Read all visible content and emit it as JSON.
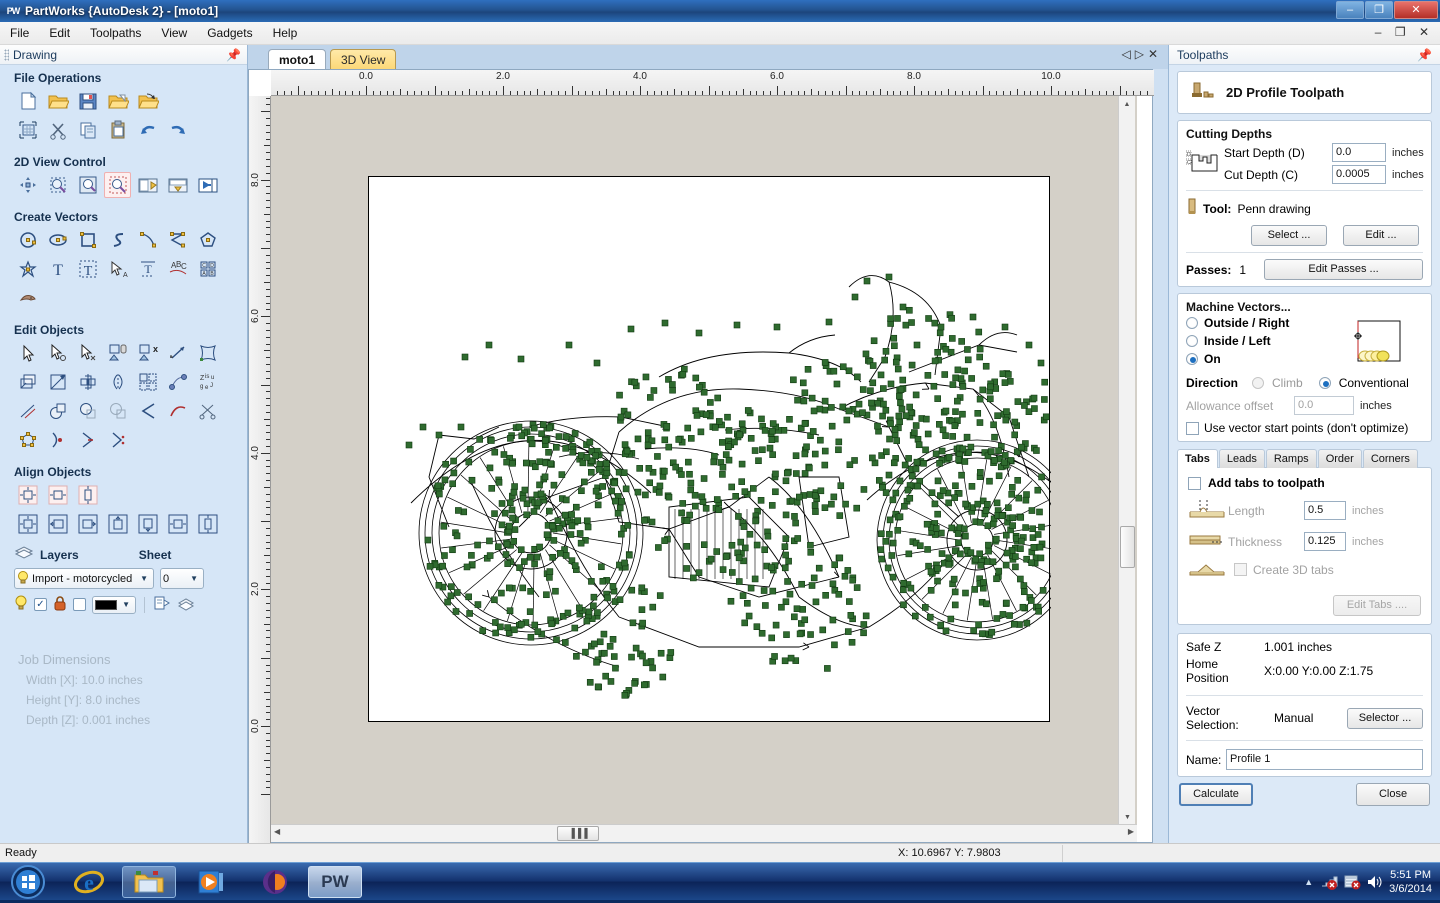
{
  "window": {
    "title": "PartWorks {AutoDesk 2} - [moto1]",
    "icon": "partworks-icon",
    "minimize": "–",
    "maximize": "❐",
    "close": "✕",
    "mdi_restore": "–",
    "mdi_max": "❐",
    "mdi_close": "✕"
  },
  "menubar": {
    "items": [
      {
        "label": "File"
      },
      {
        "label": "Edit"
      },
      {
        "label": "Toolpaths"
      },
      {
        "label": "View"
      },
      {
        "label": "Gadgets"
      },
      {
        "label": "Help"
      }
    ]
  },
  "drawing_panel": {
    "title": "Drawing",
    "pin_icon": "pin-icon",
    "groups": [
      {
        "name": "File Operations",
        "title": "File Operations",
        "rows": [
          [
            "new-file-icon",
            "open-folder-icon",
            "save-disk-icon",
            "open-recent-icon",
            "import-vectors-icon"
          ],
          [
            "job-setup-icon",
            "cut-scissors-icon",
            "copy-icon",
            "paste-icon",
            "undo-icon",
            "redo-icon"
          ]
        ]
      },
      {
        "name": "2D View Control",
        "title": "2D View Control",
        "rows": [
          [
            "pan-icon",
            "zoom-window-icon",
            "zoom-extents-icon",
            "zoom-selected-icon",
            "toggle-left-pane-icon",
            "toggle-top-pane-icon",
            "toggle-right-pane-icon"
          ]
        ]
      },
      {
        "name": "Create Vectors",
        "title": "Create Vectors",
        "rows": [
          [
            "draw-circle-icon",
            "draw-ellipse-icon",
            "draw-rectangle-icon",
            "draw-polyline-icon",
            "draw-arc-icon",
            "draw-polygon-line-icon",
            "draw-polygon-icon"
          ],
          [
            "draw-star-icon",
            "create-text-icon",
            "edit-text-icon",
            "text-select-icon",
            "text-on-curve-icon",
            "arc-text-icon",
            "text-block-icon"
          ],
          [
            "trace-bitmap-icon"
          ]
        ]
      },
      {
        "name": "Edit Objects",
        "title": "Edit Objects",
        "rows": [
          [
            "select-arrow-icon",
            "node-edit-icon",
            "transform-icon",
            "group-icon",
            "ungroup-icon",
            "measure-icon",
            "distort-icon"
          ],
          [
            "offset-icon",
            "scale-icon",
            "mirror-icon",
            "flip-icon",
            "array-copy-icon",
            "join-vectors-icon",
            "nest-icon"
          ],
          [
            "fillet-icon",
            "weld-icon",
            "subtract-icon",
            "intersect-icon",
            "trim-icon",
            "curve-fit-icon",
            "scissors-trim-icon"
          ],
          [
            "polygon-nodes-icon",
            "start-point-icon",
            "reverse-direction-icon",
            "move-start-point-icon"
          ]
        ]
      },
      {
        "name": "Align Objects",
        "title": "Align Objects",
        "rows": [
          [
            "align-center-page-icon",
            "align-horizontal-page-icon",
            "align-vertical-page-icon"
          ],
          [
            "align-center-selection-icon",
            "align-left-icon",
            "align-right-icon",
            "align-top-icon",
            "align-bottom-icon",
            "align-center-h-icon",
            "align-center-v-icon"
          ]
        ]
      }
    ],
    "layers": {
      "icon": "layers-stack-icon",
      "label": "Layers",
      "sheet_label": "Sheet",
      "selected_layer": "Import - motorcycled",
      "layer_lamp_icon": "lightbulb-icon",
      "sheet_value": "0",
      "controls": {
        "visible_icon": "lightbulb-icon",
        "checkbox_checked": "✓",
        "lock_icon": "padlock-icon",
        "blank_checkbox": "",
        "color_swatch": "#000000",
        "layer_props_icon": "layer-properties-icon",
        "merge_layers_icon": "merge-layers-icon"
      }
    },
    "job_dimensions": {
      "title": "Job Dimensions",
      "width": "Width  [X]: 10.0 inches",
      "height": "Height [Y]: 8.0 inches",
      "depth": "Depth  [Z]: 0.001 inches"
    }
  },
  "document": {
    "tabs": [
      {
        "label": "moto1",
        "active": true
      },
      {
        "label": "3D View",
        "active": false
      }
    ],
    "nav_prev": "◁",
    "nav_next": "▷",
    "close": "✕",
    "ruler_h_labels": [
      "0.0",
      "2.0",
      "4.0",
      "6.0",
      "8.0",
      "10.0"
    ],
    "ruler_v_labels": [
      "8.0",
      "6.0",
      "4.0",
      "2.0",
      "0.0"
    ],
    "hscroll_thumb_glyph": "▐▐▐",
    "vscroll_up": "▲",
    "vscroll_down": "▼",
    "hscroll_left": "◀",
    "hscroll_right": "▶",
    "artwork_name": "motorcycle-vector-drawing"
  },
  "toolpaths_panel": {
    "title": "Toolpaths",
    "pin_icon": "pin-icon",
    "header": {
      "icon": "end-mill-icon",
      "title": "2D Profile Toolpath"
    },
    "cutting_depths": {
      "title": "Cutting Depths",
      "diagram_icon": "cut-depth-diagram-icon",
      "start_depth_label": "Start Depth (D)",
      "start_depth_value": "0.0",
      "start_depth_unit": "inches",
      "cut_depth_label": "Cut Depth (C)",
      "cut_depth_value": "0.0005",
      "cut_depth_unit": "inches"
    },
    "tool": {
      "icon": "tool-bit-icon",
      "label": "Tool:",
      "value": "Penn drawing",
      "select_button": "Select ...",
      "edit_button": "Edit ..."
    },
    "passes": {
      "label": "Passes:",
      "value": "1",
      "edit_button": "Edit Passes ..."
    },
    "machine_vectors": {
      "title": "Machine Vectors...",
      "options": [
        {
          "label": "Outside / Right",
          "selected": false
        },
        {
          "label": "Inside / Left",
          "selected": false
        },
        {
          "label": "On",
          "selected": true
        }
      ],
      "preview_icon": "toolpath-preview-icon",
      "direction_label": "Direction",
      "direction_options": [
        {
          "label": "Climb",
          "selected": false,
          "disabled": true
        },
        {
          "label": "Conventional",
          "selected": true,
          "disabled": false
        }
      ],
      "allowance_label": "Allowance offset",
      "allowance_value": "0.0",
      "allowance_unit": "inches",
      "start_points_label": "Use vector start points (don't optimize)",
      "start_points_checked": false
    },
    "tabstrip": [
      {
        "label": "Tabs",
        "active": true
      },
      {
        "label": "Leads",
        "active": false
      },
      {
        "label": "Ramps",
        "active": false
      },
      {
        "label": "Order",
        "active": false
      },
      {
        "label": "Corners",
        "active": false
      }
    ],
    "tabs_pane": {
      "add_tabs_label": "Add tabs to toolpath",
      "add_tabs_checked": false,
      "length_icon": "tab-length-icon",
      "length_label": "Length",
      "length_value": "0.5",
      "length_unit": "inches",
      "thickness_icon": "tab-thickness-icon",
      "thickness_label": "Thickness",
      "thickness_value": "0.125",
      "thickness_unit": "inches",
      "tab3d_icon": "tab-3d-icon",
      "tab3d_label": "Create 3D tabs",
      "tab3d_checked": false,
      "edit_tabs_button": "Edit Tabs ...."
    },
    "footer": {
      "safe_z_label": "Safe Z",
      "safe_z_value": "1.001 inches",
      "home_label": "Home Position",
      "home_value": "X:0.00 Y:0.00 Z:1.75",
      "vector_selection_label": "Vector Selection:",
      "vector_selection_value": "Manual",
      "selector_button": "Selector ...",
      "name_label": "Name:",
      "name_value": "Profile 1",
      "calculate_button": "Calculate",
      "close_button": "Close"
    }
  },
  "statusbar": {
    "ready": "Ready",
    "coords": "X: 10.6967 Y:  7.9803"
  },
  "taskbar": {
    "start_icon": "windows-start-orb-icon",
    "buttons": [
      {
        "icon": "internet-explorer-icon",
        "name": "internet-explorer"
      },
      {
        "icon": "file-explorer-icon",
        "name": "file-explorer"
      },
      {
        "icon": "media-player-icon",
        "name": "windows-media-player"
      },
      {
        "icon": "orb-app-icon",
        "name": "orb-app"
      },
      {
        "icon": "partworks-taskbar-icon",
        "name": "partworks",
        "label": "PW"
      }
    ],
    "tray": {
      "show_hidden_icon": "chevron-up-icon",
      "network_icon": "network-error-icon",
      "action-center_icon": "flag-error-icon",
      "volume_icon": "speaker-icon",
      "time": "5:51 PM",
      "date": "3/6/2014"
    }
  },
  "colors": {
    "node_marker": "#2f6b2f",
    "vector_line": "#000000",
    "panel_bg": "#dce9f7",
    "titlebar": "#23538f",
    "accent": "#1d6fc0"
  }
}
